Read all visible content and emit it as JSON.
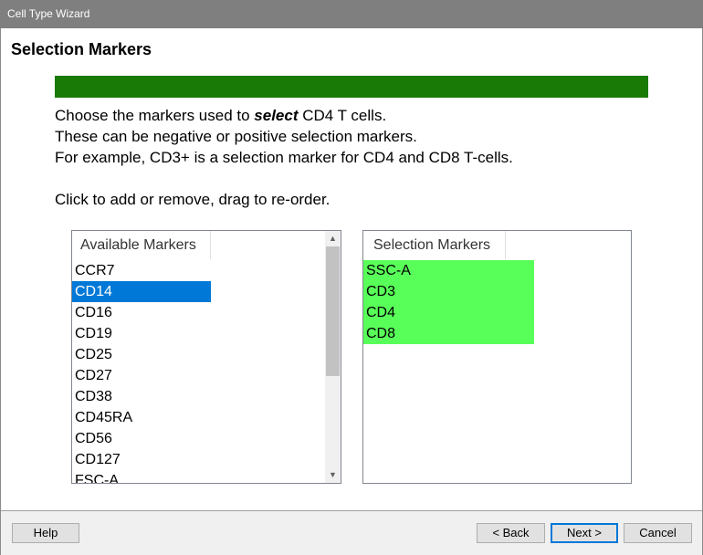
{
  "window": {
    "title": "Cell Type Wizard"
  },
  "page": {
    "title": "Selection Markers"
  },
  "instructions": {
    "line1_before": "Choose the markers used to ",
    "line1_emphasis": "select",
    "line1_after": " CD4 T cells.",
    "line2": "These can be negative or positive selection markers.",
    "line3": "For example, CD3+ is a selection marker for CD4 and CD8 T-cells.",
    "line4": "Click to add or remove, drag to re-order."
  },
  "available": {
    "header": "Available Markers",
    "items": [
      "CCR7",
      "CD14",
      "CD16",
      "CD19",
      "CD25",
      "CD27",
      "CD38",
      "CD45RA",
      "CD56",
      "CD127",
      "FSC-A"
    ],
    "selected": "CD14"
  },
  "selection": {
    "header": "Selection Markers",
    "items": [
      "SSC-A",
      "CD3",
      "CD4",
      "CD8"
    ]
  },
  "colors": {
    "progress": "#1a7a06",
    "selected_marker_bg": "#59ff59",
    "highlight": "#0078d7"
  },
  "icons": {
    "scroll_up": "chevron-up-icon",
    "scroll_down": "chevron-down-icon"
  },
  "buttons": {
    "help": "Help",
    "back": "< Back",
    "next": "Next >",
    "cancel": "Cancel"
  }
}
